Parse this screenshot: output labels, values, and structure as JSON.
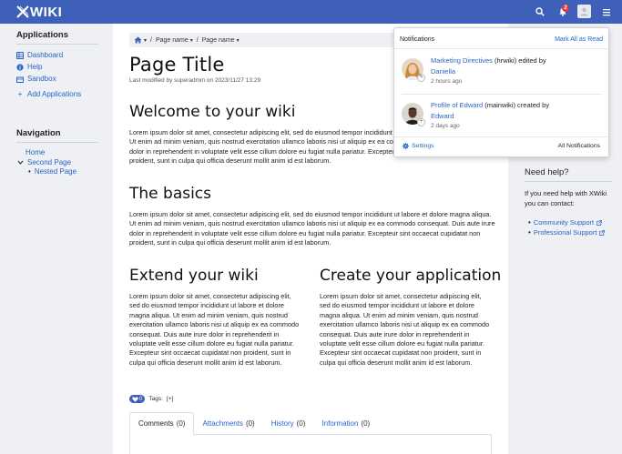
{
  "topbar": {
    "logo_text": "WIKI",
    "badge_count": "2",
    "colors": {
      "bar": "#3e60b8",
      "badge": "#e53935"
    }
  },
  "left": {
    "applications_title": "Applications",
    "apps": [
      {
        "label": "Dashboard",
        "icon": "table-icon"
      },
      {
        "label": "Help",
        "icon": "info-icon"
      },
      {
        "label": "Sandbox",
        "icon": "sandbox-icon"
      }
    ],
    "add_label": "Add Applications",
    "navigation_title": "Navigation",
    "nav": [
      {
        "label": "Home"
      },
      {
        "label": "Second Page"
      },
      {
        "label": "Nested Page"
      }
    ]
  },
  "main": {
    "breadcrumb": [
      "Page name",
      "Page name"
    ],
    "title": "Page Title",
    "modified": "Last modified by superadmin on 2023/11/27 13:29",
    "sections": {
      "welcome": "Welcome to your wiki",
      "basics": "The basics",
      "extend": "Extend your wiki",
      "create": "Create your application"
    },
    "lorem_long": "Lorem ipsum dolor sit amet, consectetur adipiscing elit, sed do eiusmod tempor incididunt ut labore et dolore magna aliqua. Ut enim ad minim veniam, quis nostrud exercitation ullamco laboris nisi ut aliquip ex ea commodo consequat. Duis aute irure dolor in reprehenderit in voluptate velit esse cillum dolore eu fugiat nulla pariatur. Excepteur sint occaecat cupidatat non proident, sunt in culpa qui officia deserunt mollit anim id est laborum.",
    "like_count": "0",
    "tags_label": "Tags:",
    "tags_add": "[+]",
    "tabs": [
      {
        "label": "Comments",
        "count": "(0)"
      },
      {
        "label": "Attachments",
        "count": "(0)"
      },
      {
        "label": "History",
        "count": "(0)"
      },
      {
        "label": "Information",
        "count": "(0)"
      }
    ]
  },
  "right": {
    "help_title": "Need help?",
    "help_text": "If you need help with XWiki you can contact:",
    "links": [
      {
        "label": "Community Support"
      },
      {
        "label": "Professional Support"
      }
    ]
  },
  "notifications": {
    "title": "Notifications",
    "mark_all": "Mark All as Read",
    "items": [
      {
        "link": "Marketing Directives",
        "rest": " (hrwiki) edited by",
        "user": "Daniella",
        "time": "2 hours ago"
      },
      {
        "link": "Profile of Edward",
        "rest": " (mainwiki) created by",
        "user": "Edward",
        "time": "2 days ago"
      }
    ],
    "settings": "Settings",
    "all": "All Notifications"
  }
}
